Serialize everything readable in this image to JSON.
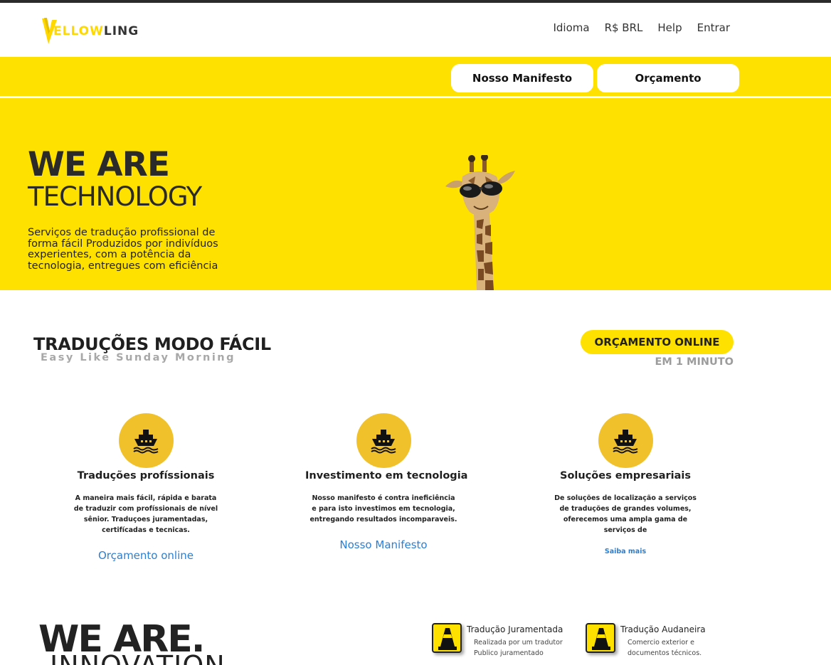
{
  "brand": {
    "logo_prefix": "ELLOW",
    "logo_suffix": "LING",
    "accent": "#ffe100"
  },
  "nav": {
    "items": [
      "Idioma",
      "R$ BRL",
      "Help",
      "Entrar"
    ]
  },
  "action_bar": {
    "manifesto_label": "Nosso Manifesto",
    "orcamento_label": "Orçamento"
  },
  "hero": {
    "title_line1": "WE ARE",
    "title_line2": "TECHNOLOGY",
    "description": "Serviços de tradução profissional de forma fácil Produzidos por indivíduos experientes, com a potência da tecnologia, entregues com eficiência"
  },
  "section": {
    "title": "TRADUÇÕES MODO FÁCIL",
    "subtitle": "Easy Like Sunday Morning",
    "quote_button": "ORÇAMENTO ONLINE",
    "quote_sub": "EM 1 MINUTO"
  },
  "features": [
    {
      "icon": "ship-icon",
      "title": "Traduções profíssionais",
      "description": "A maneira mais fácil, rápida e barata de traduzir com profíssionais de nível sênior. Traduçoes juramentadas, certifícadas e tecnicas.",
      "link": "Orçamento online"
    },
    {
      "icon": "ship-icon",
      "title": "Investimento em tecnologia",
      "description": "Nosso manifesto é contra ineficiência e para isto investimos em tecnologia, entregando resultados incomparaveis.",
      "link": "Nosso Manifesto"
    },
    {
      "icon": "ship-icon",
      "title": "Soluções empresariais",
      "description": "De soluções de localização a serviços de traduções de grandes volumes, oferecemos uma ampla gama de serviços de",
      "link": "Saiba mais"
    }
  ],
  "bottom": {
    "title": "WE ARE.",
    "subtitle": "INNOVATION",
    "services": [
      {
        "icon": "traffic-cone-icon",
        "title": "Tradução Juramentada",
        "description": "Realizada por um tradutor Publico juramentado"
      },
      {
        "icon": "traffic-cone-icon",
        "title": "Tradução Audaneira",
        "description": "Comercio exterior e documentos técnicos."
      }
    ]
  }
}
